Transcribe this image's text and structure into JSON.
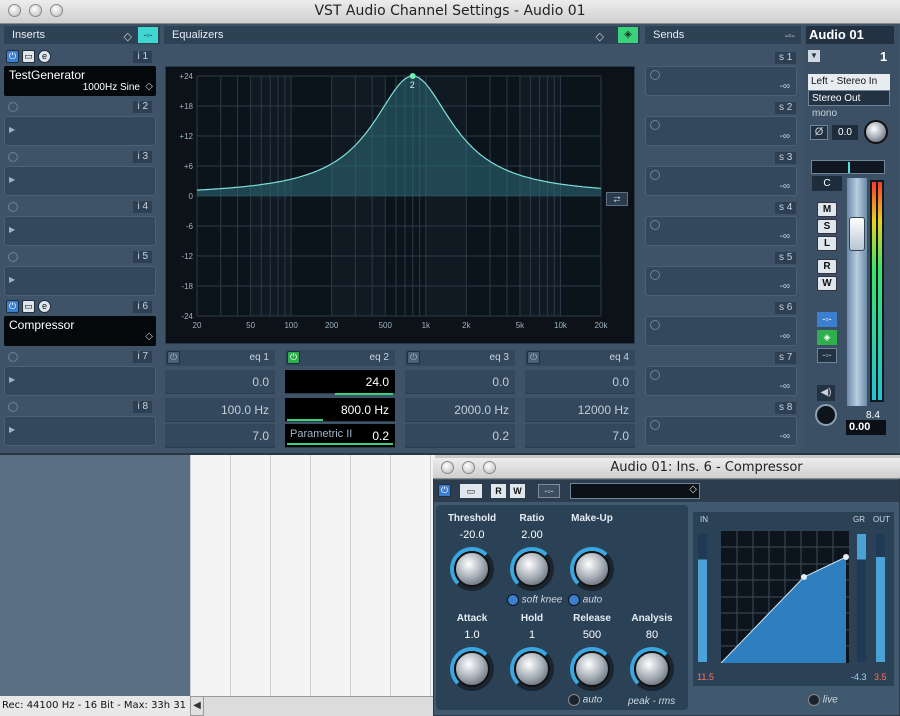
{
  "main_window": {
    "title": "VST Audio Channel Settings - Audio 01",
    "inserts_header": "Inserts",
    "equalizers_header": "Equalizers",
    "sends_header": "Sends",
    "channel_name": "Audio 01",
    "channel_number": "1"
  },
  "inserts": [
    {
      "num": "i 1",
      "name": "TestGenerator",
      "sub": "1000Hz Sine"
    },
    {
      "num": "i 2",
      "name": "",
      "sub": ""
    },
    {
      "num": "i 3",
      "name": "",
      "sub": ""
    },
    {
      "num": "i 4",
      "name": "",
      "sub": ""
    },
    {
      "num": "i 5",
      "name": "",
      "sub": ""
    },
    {
      "num": "i 6",
      "name": "Compressor",
      "sub": ""
    },
    {
      "num": "i 7",
      "name": "",
      "sub": ""
    },
    {
      "num": "i 8",
      "name": "",
      "sub": ""
    }
  ],
  "sends": [
    {
      "num": "s 1",
      "value": "-∞"
    },
    {
      "num": "s 2",
      "value": "-∞"
    },
    {
      "num": "s 3",
      "value": "-∞"
    },
    {
      "num": "s 4",
      "value": "-∞"
    },
    {
      "num": "s 5",
      "value": "-∞"
    },
    {
      "num": "s 6",
      "value": "-∞"
    },
    {
      "num": "s 7",
      "value": "-∞"
    },
    {
      "num": "s 8",
      "value": "-∞"
    }
  ],
  "eq_graph": {
    "y_ticks": [
      "+24",
      "+18",
      "+12",
      "+6",
      "0",
      "-6",
      "-12",
      "-18",
      "-24"
    ],
    "x_ticks": [
      "20",
      "50",
      "100",
      "200",
      "500",
      "1k",
      "2k",
      "5k",
      "10k",
      "20k"
    ],
    "point_label": "2",
    "curve": {
      "center_hz": 800,
      "gain_db": 24,
      "q": 0.2
    }
  },
  "eq_bands": [
    {
      "label": "eq 1",
      "gain": "0.0",
      "freq": "100.0 Hz",
      "q": "7.0",
      "type": ""
    },
    {
      "label": "eq 2",
      "gain": "24.0",
      "freq": "800.0 Hz",
      "q": "0.2",
      "type": "Parametric II"
    },
    {
      "label": "eq 3",
      "gain": "0.0",
      "freq": "2000.0 Hz",
      "q": "0.2",
      "type": ""
    },
    {
      "label": "eq 4",
      "gain": "0.0",
      "freq": "12000 Hz",
      "q": "7.0",
      "type": ""
    }
  ],
  "routing": {
    "input": "Left - Stereo In",
    "output": "Stereo Out",
    "mode": "mono",
    "phase": "0.0",
    "pan": "C",
    "fader_value": "0.00",
    "meter_peak": "8.4"
  },
  "channel_buttons": [
    "M",
    "S",
    "L",
    "R",
    "W"
  ],
  "status_bar": "Rec: 44100 Hz - 16 Bit - Max: 33h 31",
  "compressor": {
    "title": "Audio 01: Ins. 6 - Compressor",
    "threshold_label": "Threshold",
    "threshold": "-20.0",
    "ratio_label": "Ratio",
    "ratio": "2.00",
    "makeup_label": "Make-Up",
    "soft_knee": "soft knee",
    "auto": "auto",
    "attack_label": "Attack",
    "attack": "1.0",
    "hold_label": "Hold",
    "hold": "1",
    "release_label": "Release",
    "release": "500",
    "analysis_label": "Analysis",
    "analysis": "80",
    "release_auto": "auto",
    "peak_rms": "peak - rms",
    "in_label": "IN",
    "gr_label": "GR",
    "out_label": "OUT",
    "in_value": "11.5",
    "gr_value": "-4.3",
    "out_value": "3.5",
    "live": "live"
  }
}
